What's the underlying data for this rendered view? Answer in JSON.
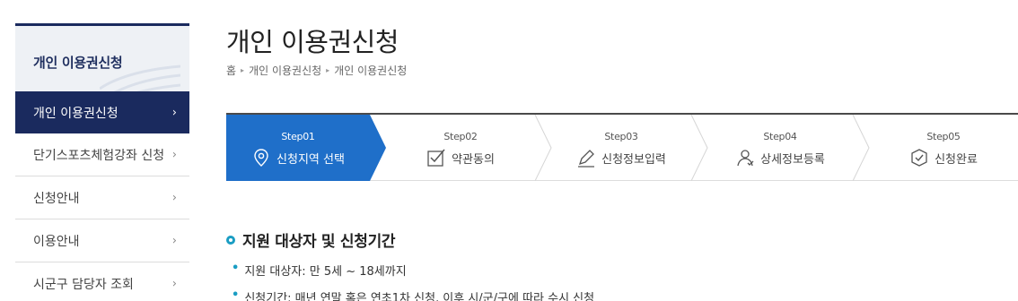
{
  "sidebar": {
    "title": "개인 이용권신청",
    "items": [
      {
        "label": "개인 이용권신청",
        "active": true
      },
      {
        "label": "단기스포츠체험강좌 신청"
      },
      {
        "label": "신청안내"
      },
      {
        "label": "이용안내"
      },
      {
        "label": "시군구 담당자 조회"
      }
    ],
    "chevron": "›"
  },
  "header": {
    "title": "개인 이용권신청",
    "breadcrumb": [
      "홈",
      "개인 이용권신청",
      "개인 이용권신청"
    ],
    "breadcrumb_sep": "▸"
  },
  "steps": [
    {
      "num": "Step01",
      "label": "신청지역 선택",
      "icon": "location-pin-icon",
      "active": true
    },
    {
      "num": "Step02",
      "label": "약관동의",
      "icon": "checkbox-icon"
    },
    {
      "num": "Step03",
      "label": "신청정보입력",
      "icon": "pencil-icon"
    },
    {
      "num": "Step04",
      "label": "상세정보등록",
      "icon": "person-icon"
    },
    {
      "num": "Step05",
      "label": "신청완료",
      "icon": "check-shield-icon"
    }
  ],
  "section": {
    "title": "지원 대상자 및 신청기간",
    "bullets": [
      "지원 대상자: 만 5세 ~ 18세까지",
      "신청기간: 매년 연말 혹은 연초1차 신청, 이후 시/군/구에 따라 수시 신청"
    ]
  },
  "colors": {
    "navy": "#1a2a5e",
    "step_active": "#1f6fc9",
    "accent": "#1a9dc3"
  }
}
